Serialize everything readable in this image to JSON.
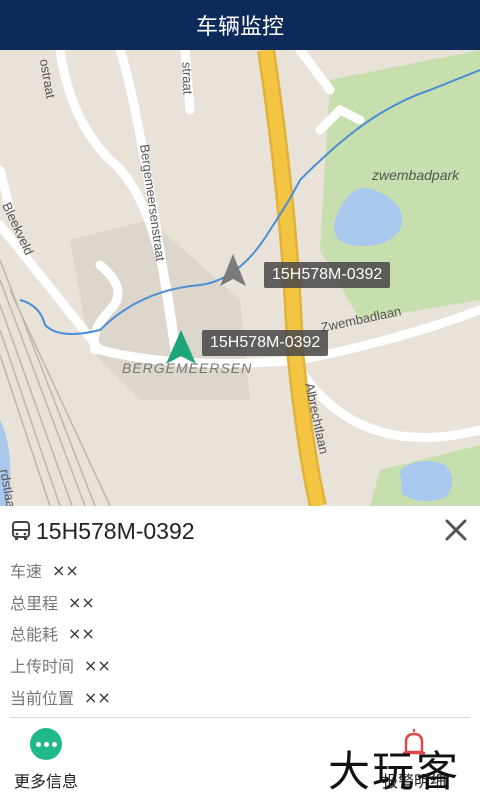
{
  "header": {
    "title": "车辆监控"
  },
  "map": {
    "street_labels": [
      "ostraat",
      "straat",
      "Bergemeersenstraat",
      "Bleekveld",
      "zwembadpark",
      "Zwembadlaan",
      "BERGEMEERSEN",
      "Albrechtlaan",
      "rdstlaa"
    ],
    "vehicles": [
      {
        "label": "15H578M-0392",
        "marker_color": "#7a7a7a"
      },
      {
        "label": "15H578M-0392",
        "marker_color": "#1fa57a"
      }
    ],
    "colors": {
      "land": "#e8e2d8",
      "park": "#c7dfae",
      "water": "#a8c8ee",
      "highway": "#f4c542",
      "route": "#4a8fd4"
    }
  },
  "panel": {
    "vehicle_icon": "bus-icon",
    "plate": "15H578M-0392",
    "fields": [
      {
        "label": "车速",
        "value": "××"
      },
      {
        "label": "总里程",
        "value": "××"
      },
      {
        "label": "总能耗",
        "value": "××"
      },
      {
        "label": "上传时间",
        "value": "××"
      },
      {
        "label": "当前位置",
        "value": "××"
      }
    ],
    "more_label": "更多信息",
    "alarm_label": "报警明细",
    "watermark": "大玩客"
  }
}
